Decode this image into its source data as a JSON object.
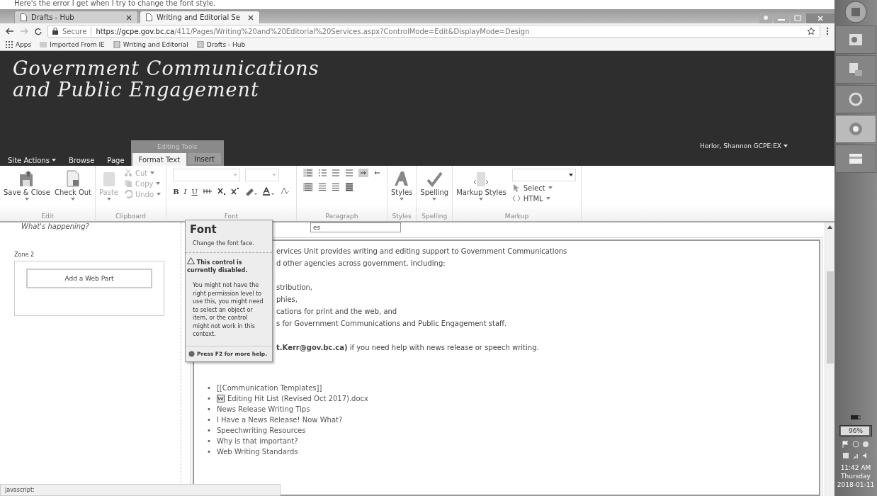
{
  "caption": "Here's the error I get when I try to change the font style.",
  "browser": {
    "tabs": [
      {
        "title": "Drafts - Hub",
        "selected": false
      },
      {
        "title": "Writing and Editorial Se",
        "selected": true
      }
    ],
    "url": {
      "secure_label": "Secure",
      "host": "https://gcpe.gov.bc.ca",
      "path": "/411/Pages/Writing%20and%20Editorial%20Services.aspx?ControlMode=Edit&DisplayMode=Design"
    },
    "bookmarks": [
      {
        "label": "Apps",
        "kind": "apps"
      },
      {
        "label": "Imported From IE",
        "kind": "folder"
      },
      {
        "label": "Writing and Editorial",
        "kind": "page"
      },
      {
        "label": "Drafts - Hub",
        "kind": "page"
      }
    ]
  },
  "site": {
    "title_lines": [
      "Government Communications",
      "and Public Engagement"
    ],
    "contextual_label": "Editing Tools",
    "tabs": [
      {
        "label": "Site Actions",
        "selected": false,
        "menu": true,
        "contextual": false
      },
      {
        "label": "Browse",
        "selected": false,
        "menu": false,
        "contextual": false
      },
      {
        "label": "Page",
        "selected": false,
        "menu": false,
        "contextual": false
      },
      {
        "label": "Format Text",
        "selected": true,
        "menu": false,
        "contextual": true
      },
      {
        "label": "Insert",
        "selected": false,
        "menu": false,
        "contextual": true
      }
    ],
    "user": "Horlor, Shannon GCPE:EX"
  },
  "ribbon": [
    {
      "label": "Edit",
      "items": [
        {
          "kind": "large",
          "label": "Save & Close",
          "disabled": false
        },
        {
          "kind": "large",
          "label": "Check Out",
          "disabled": false
        }
      ]
    },
    {
      "label": "Clipboard",
      "items": [
        {
          "kind": "large",
          "label": "Paste",
          "disabled": true
        },
        {
          "kind": "stack",
          "entries": [
            {
              "label": "Cut",
              "disabled": true
            },
            {
              "label": "Copy",
              "disabled": true
            },
            {
              "label": "Undo",
              "disabled": true
            }
          ]
        }
      ]
    },
    {
      "label": "Font",
      "items": [
        {
          "kind": "font",
          "buttons": [
            "B",
            "I",
            "U"
          ]
        }
      ]
    },
    {
      "label": "Paragraph",
      "items": [
        {
          "kind": "paragraph"
        }
      ]
    },
    {
      "label": "Styles",
      "items": [
        {
          "kind": "large",
          "label": "Styles",
          "disabled": false
        }
      ]
    },
    {
      "label": "Spelling",
      "items": [
        {
          "kind": "large",
          "label": "Spelling",
          "disabled": false
        }
      ]
    },
    {
      "label": "Markup",
      "items": [
        {
          "kind": "large",
          "label": "Markup Styles",
          "disabled": false
        },
        {
          "kind": "stack",
          "entries": [
            {
              "label": "Select",
              "disabled": false
            },
            {
              "label": "HTML",
              "disabled": false
            }
          ],
          "dropdown": true
        }
      ]
    }
  ],
  "left_zone": {
    "heading": "What's happening?",
    "zone_label": "Zone 2",
    "add_button": "Add a Web Part"
  },
  "editor": {
    "field_value": "es",
    "paragraphs": [
      [
        "ervices Unit provides writing and editing support to Government Communications",
        "d other agencies across government, including:"
      ],
      [
        "stribution,",
        "phies,",
        "cations for print and the web, and",
        "s for Government Communications and Public Engagement staff."
      ],
      [
        "**t.Kerr@gov.bc.ca)** if you need help with news release or speech writing."
      ]
    ],
    "links": [
      {
        "marker": "•",
        "label": "[[Communication Templates]]",
        "kind": "text"
      },
      {
        "marker": "•",
        "label": "Editing Hit List (Revised Oct 2017).docx",
        "kind": "file"
      },
      {
        "marker": "•",
        "label": "News Release Writing Tips",
        "kind": "text"
      },
      {
        "marker": "•",
        "label": "I Have a News Release! Now What?",
        "kind": "text"
      },
      {
        "marker": "•",
        "label": "Speechwriting Resources",
        "kind": "text"
      },
      {
        "marker": "•",
        "label": "Why is that important?",
        "kind": "text"
      },
      {
        "marker": "•",
        "label": "Web Writing Standards",
        "kind": "text"
      }
    ]
  },
  "tooltip": {
    "title": "Font",
    "description": "Change the font face.",
    "warning": "This control is currently disabled.",
    "body": "You might not have the right permission level to use this, you might need to select an object or item, or the control might not work in this context.",
    "help": "Press F2 for more help."
  },
  "status_bar": "javascript:",
  "taskbar": {
    "apps": [
      {
        "selected": false
      },
      {
        "selected": false
      },
      {
        "selected": false
      },
      {
        "selected": true
      },
      {
        "selected": false
      }
    ],
    "battery": {
      "label": "96%",
      "level": 0.96
    },
    "clock": [
      "11:42 AM",
      "Thursday",
      "2018-01-11"
    ]
  }
}
